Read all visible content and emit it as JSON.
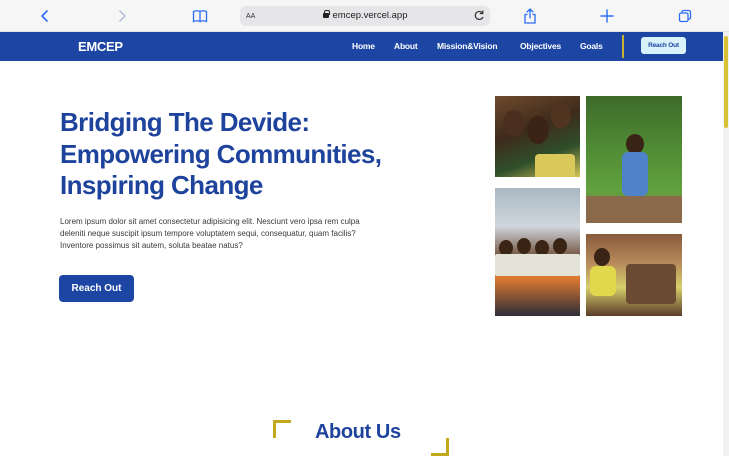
{
  "browser": {
    "text_size_label": "AA",
    "url": "emcep.vercel.app",
    "icons": [
      "back-icon",
      "forward-icon",
      "bookmarks-icon",
      "lock-icon",
      "reload-icon",
      "share-icon",
      "new-tab-icon",
      "tabs-icon"
    ]
  },
  "nav": {
    "brand": "EMCEP",
    "items": [
      "Home",
      "About",
      "Mission&Vision",
      "Objectives",
      "Goals"
    ],
    "cta": "Reach Out"
  },
  "hero": {
    "title": "Bridging The Devide: Empowering Communities, Inspiring Change",
    "text": "Lorem ipsum dolor sit amet consectetur adipisicing elit. Nesciunt vero ipsa rem culpa deleniti neque suscipit ipsum tempore voluptatem sequi, consequatur, quam facilis? Inventore possimus sit autem, soluta beatae natus?",
    "cta": "Reach Out"
  },
  "about": {
    "title": "About Us"
  },
  "colors": {
    "primary": "#1d45a3",
    "accent": "#c2a91d",
    "cta_light": "#d8f1fb"
  }
}
